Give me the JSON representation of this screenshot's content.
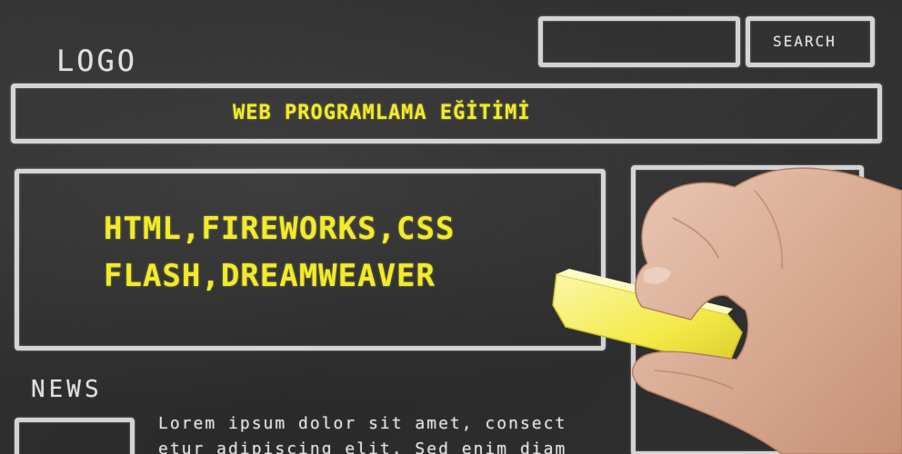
{
  "header": {
    "logo_text": "LOGO",
    "search_button_label": "SEARCH"
  },
  "nav": {
    "title": "WEB PROGRAMLAMA EĞİTİMİ"
  },
  "main": {
    "line_1": "HTML,FIREWORKS,CSS",
    "line_2": "FLASH,DREAMWEAVER"
  },
  "news": {
    "heading": "NEWS",
    "line_1": "Lorem ipsum dolor sit amet, consect",
    "line_2": "etur adipiscing elit. Sed enim diam"
  },
  "colors": {
    "chalk_white": "#ebebeb",
    "chalk_yellow": "#f2ea2c",
    "board": "#2e2e2e"
  }
}
